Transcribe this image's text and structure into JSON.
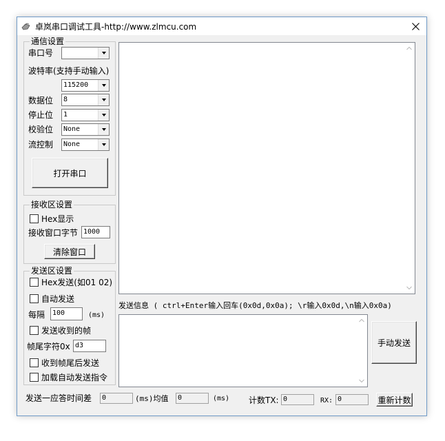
{
  "window": {
    "title": "卓岚串口调试工具-http://www.zlmcu.com"
  },
  "comm": {
    "group_title": "通信设置",
    "port_label": "串口号",
    "port_value": "",
    "baud_label": "波特率(支持手动输入)",
    "baud_value": "115200",
    "databits_label": "数据位",
    "databits_value": "8",
    "stopbits_label": "停止位",
    "stopbits_value": "1",
    "parity_label": "校验位",
    "parity_value": "None",
    "flow_label": "流控制",
    "flow_value": "None",
    "open_button": "打开串口"
  },
  "receive": {
    "group_title": "接收区设置",
    "hex_display_label": "Hex显示",
    "hex_display_checked": false,
    "window_bytes_label": "接收窗口字节",
    "window_bytes_value": "1000",
    "clear_button": "清除窗口"
  },
  "send": {
    "group_title": "发送区设置",
    "hex_send_label": "Hex发送(如01 02)",
    "hex_send_checked": false,
    "auto_send_label": "自动发送",
    "auto_send_checked": false,
    "interval_label": "每隔",
    "interval_value": "100",
    "interval_unit": "(ms)",
    "send_on_receive_label": "发送收到的帧",
    "frame_tail_label": "帧尾字符0x",
    "frame_tail_value": "d3",
    "send_after_tail_label": "收到帧尾后发送",
    "load_auto_cmd_label": "加载自动发送指令"
  },
  "send_info": {
    "label": "发送信息 ( ctrl+Enter输入回车(0x0d,0x0a); \\r输入0x0d,\\n输入0x0a)",
    "text": "",
    "manual_send_button": "手动发送"
  },
  "status": {
    "response_time_label": "发送一应答时间差",
    "response_time_value": "0",
    "ms_avg_label": "(ms)均值",
    "avg_value": "0",
    "ms_label": "(ms)",
    "tx_label": "计数TX:",
    "tx_value": "0",
    "rx_label": "RX:",
    "rx_value": "0",
    "reset_button": "重新计数"
  }
}
